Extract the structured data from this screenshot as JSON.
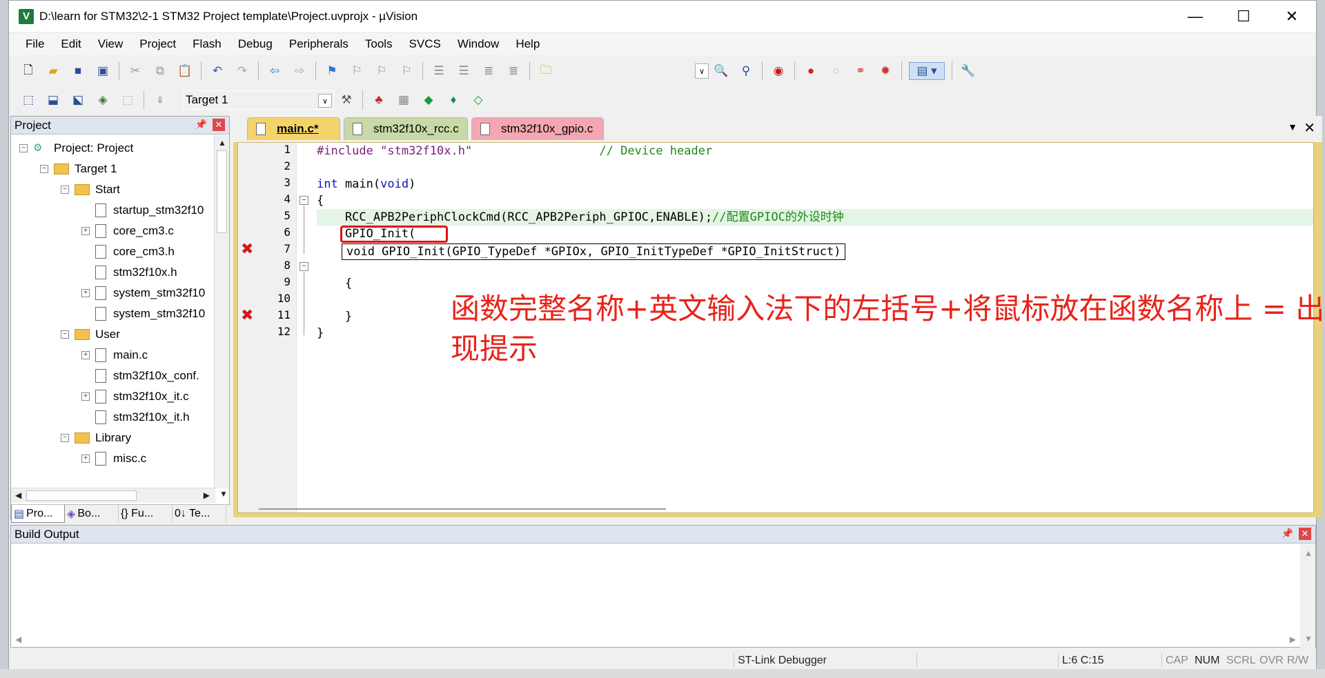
{
  "window": {
    "title": "D:\\learn for STM32\\2-1 STM32 Project template\\Project.uvprojx - µVision",
    "app_icon_letter": "V",
    "minimize": "—",
    "maximize": "☐",
    "close": "✕"
  },
  "menu": [
    "File",
    "Edit",
    "View",
    "Project",
    "Flash",
    "Debug",
    "Peripherals",
    "Tools",
    "SVCS",
    "Window",
    "Help"
  ],
  "toolbar2": {
    "target": "Target 1"
  },
  "project_panel": {
    "title": "Project",
    "tree": [
      {
        "label": "Project: Project",
        "level": 0,
        "expander": "−",
        "kind": "project"
      },
      {
        "label": "Target 1",
        "level": 1,
        "expander": "−",
        "kind": "folder"
      },
      {
        "label": "Start",
        "level": 2,
        "expander": "−",
        "kind": "folder"
      },
      {
        "label": "startup_stm32f10",
        "level": 3,
        "expander": "",
        "kind": "file"
      },
      {
        "label": "core_cm3.c",
        "level": 3,
        "expander": "+",
        "kind": "file"
      },
      {
        "label": "core_cm3.h",
        "level": 3,
        "expander": "",
        "kind": "file"
      },
      {
        "label": "stm32f10x.h",
        "level": 3,
        "expander": "",
        "kind": "file"
      },
      {
        "label": "system_stm32f10",
        "level": 3,
        "expander": "+",
        "kind": "file"
      },
      {
        "label": "system_stm32f10",
        "level": 3,
        "expander": "",
        "kind": "file"
      },
      {
        "label": "User",
        "level": 2,
        "expander": "−",
        "kind": "folder"
      },
      {
        "label": "main.c",
        "level": 3,
        "expander": "+",
        "kind": "file"
      },
      {
        "label": "stm32f10x_conf.",
        "level": 3,
        "expander": "",
        "kind": "file"
      },
      {
        "label": "stm32f10x_it.c",
        "level": 3,
        "expander": "+",
        "kind": "file"
      },
      {
        "label": "stm32f10x_it.h",
        "level": 3,
        "expander": "",
        "kind": "file"
      },
      {
        "label": "Library",
        "level": 2,
        "expander": "−",
        "kind": "folder"
      },
      {
        "label": "misc.c",
        "level": 3,
        "expander": "+",
        "kind": "file"
      }
    ],
    "tabs": [
      "Pro...",
      "Bo...",
      "{} Fu...",
      "0↓ Te..."
    ]
  },
  "editor": {
    "tabs": [
      "main.c*",
      "stm32f10x_rcc.c",
      "stm32f10x_gpio.c"
    ],
    "line_numbers": [
      "1",
      "2",
      "3",
      "4",
      "5",
      "6",
      "7",
      "8",
      "9",
      "10",
      "11",
      "12"
    ],
    "code": {
      "l1_pp": "#include",
      "l1_str": " \"stm32f10x.h\"",
      "l1_cmt": "                  // Device header",
      "l3_kw1": "int",
      "l3_txt": " main(",
      "l3_kw2": "void",
      "l3_end": ")",
      "l4": "{",
      "l5_code": "    RCC_APB2PeriphClockCmd(RCC_APB2Periph_GPIOC,ENABLE);",
      "l5_cmt": "//配置GPIOC的外设时钟",
      "l6": "    GPIO_Init(",
      "l8": "    {",
      "l10": "    }",
      "l11": "}"
    },
    "tooltip": "void GPIO_Init(GPIO_TypeDef *GPIOx, GPIO_InitTypeDef *GPIO_InitStruct)",
    "annotation": "函数完整名称+英文输入法下的左括号+将鼠标放在函数名称上 = 出现提示"
  },
  "build_output": {
    "title": "Build Output"
  },
  "status": {
    "debugger": "ST-Link Debugger",
    "position": "L:6 C:15",
    "cap": "CAP",
    "num": "NUM",
    "scrl": "SCRL",
    "ovr": "OVR",
    "rw": "R/W"
  },
  "colors": {
    "error_marker": "#d01a1a",
    "annotation": "#e8231a",
    "tab_main": "#f5d36b",
    "tab_rcc": "#c8d9a7",
    "tab_gpio": "#f3a7b3"
  }
}
